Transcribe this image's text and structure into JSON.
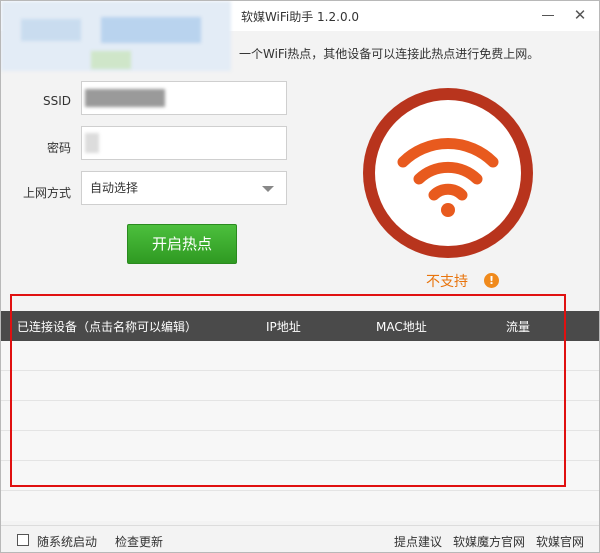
{
  "window": {
    "title": "软媒WiFi助手 1.2.0.0",
    "minimize_icon": "minimize-icon",
    "close_symbol": "✕"
  },
  "tagline": "一个WiFi热点，其他设备可以连接此热点进行免费上网。",
  "form": {
    "ssid_label": "SSID",
    "ssid_value": "",
    "password_label": "密码",
    "password_value": "",
    "mode_label": "上网方式",
    "mode_value": "自动选择",
    "start_button": "开启热点"
  },
  "status": {
    "text": "不支持",
    "warn_symbol": "!",
    "color": "#e8740c"
  },
  "table": {
    "columns": [
      "已连接设备（点击名称可以编辑）",
      "IP地址",
      "MAC地址",
      "流量"
    ]
  },
  "footer": {
    "autostart_label": "随系统启动",
    "check_update": "检查更新",
    "feedback": "提点建议",
    "mofang_site": "软媒魔方官网",
    "ruanmei_site": "软媒官网"
  },
  "colors": {
    "accent_green": "#3aaa2c",
    "wifi_ring": "#b8341d",
    "wifi_orange": "#e85a1e",
    "header_bg": "#4a4a4a",
    "highlight_red": "#e01010"
  }
}
